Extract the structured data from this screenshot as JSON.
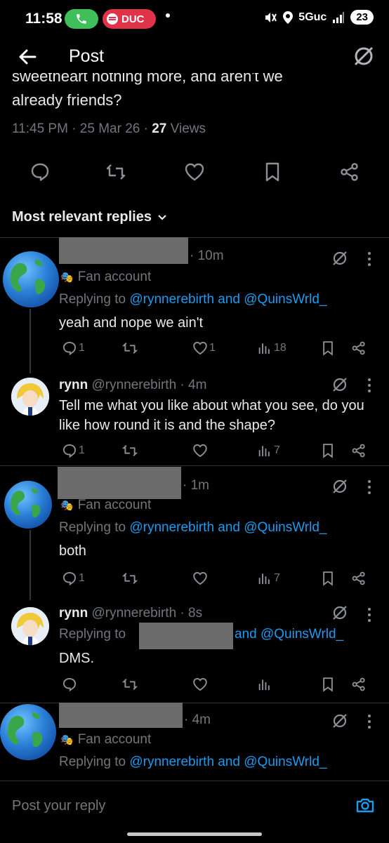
{
  "status_bar": {
    "time": "11:58",
    "spotify_label": "DUC",
    "network": "5Guc",
    "battery": "23"
  },
  "header": {
    "title": "Post"
  },
  "main_post": {
    "text_cut": "sweetheart nothing more, and aren't we",
    "text_line2": "already friends?",
    "time": "11:45 PM · 25 Mar 26 · ",
    "views_count": "27",
    "views_label": " Views"
  },
  "replies_header": "Most relevant replies",
  "replies": [
    {
      "handle_time": "· 10m",
      "fan_label": "Fan account",
      "replying_prefix": "Replying to ",
      "replying_links": "@rynnerebirth and @QuinsWrld_",
      "text": "yeah and nope we ain't",
      "replies": "1",
      "likes": "1",
      "views": "18"
    },
    {
      "name": "rynn",
      "handle": "@rynnerebirth · 4m",
      "text": "Tell me what you like about what you see, do you like how round it is and the shape?",
      "replies": "1",
      "views": "7"
    },
    {
      "handle_time": "· 1m",
      "fan_label": "Fan account",
      "replying_prefix": "Replying to ",
      "replying_links": "@rynnerebirth and @QuinsWrld_",
      "text": "both",
      "replies": "1",
      "views": "7"
    },
    {
      "name": "rynn",
      "handle": "@rynnerebirth · 8s",
      "replying_prefix": "Replying to",
      "replying_links": "and @QuinsWrld_",
      "text": "DMS."
    },
    {
      "handle_time": "· 4m",
      "fan_label": "Fan account",
      "replying_prefix": "Replying to ",
      "replying_links": "@rynnerebirth and @QuinsWrld_"
    }
  ],
  "compose": {
    "placeholder": "Post your reply"
  },
  "colors": {
    "accent": "#1d9bf0",
    "muted": "#71767b",
    "text": "#e7e9ea",
    "background": "#000000"
  }
}
